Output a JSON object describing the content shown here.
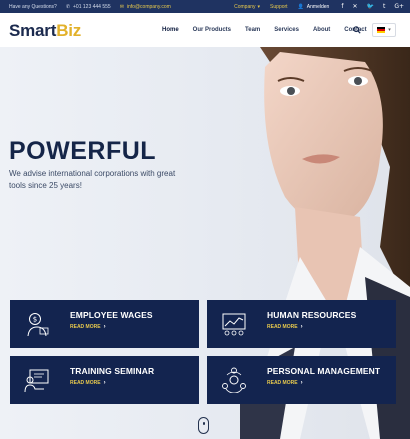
{
  "topbar": {
    "question": "Have any Questions?",
    "phone": "+01 123 444 555",
    "email": "info@company.com",
    "company": "Company",
    "support": "Support",
    "login": "Anmelden",
    "social_icons": [
      "facebook-icon",
      "xing-icon",
      "twitter-icon",
      "tumblr-icon",
      "google-plus-icon"
    ]
  },
  "header": {
    "logo_main": "Smart",
    "logo_accent": "Biz",
    "nav": [
      "Home",
      "Our Products",
      "Team",
      "Services",
      "About",
      "Contact"
    ],
    "lang_selected": "German"
  },
  "hero": {
    "title": "POWERFUL",
    "subtitle": "We advise international corporations with great tools since 25 years!"
  },
  "cards": [
    {
      "title": "EMPLOYEE WAGES",
      "more": "READ MORE",
      "icon": "employee-wages-icon"
    },
    {
      "title": "HUMAN RESOURCES",
      "more": "READ MORE",
      "icon": "human-resources-icon"
    },
    {
      "title": "TRAINING SEMINAR",
      "more": "READ MORE",
      "icon": "training-seminar-icon"
    },
    {
      "title": "PERSONAL MANAGEMENT",
      "more": "READ MORE",
      "icon": "personal-management-icon"
    }
  ],
  "colors": {
    "navy": "#13244f",
    "topbar": "#1f3361",
    "accent": "#e6c84d"
  }
}
